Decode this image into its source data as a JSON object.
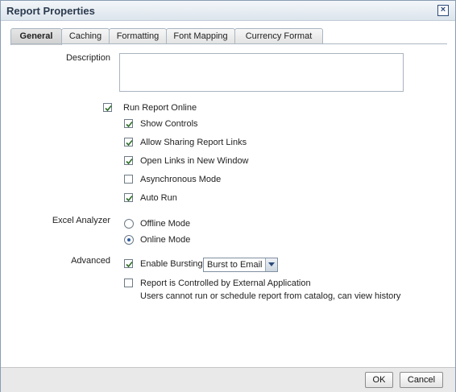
{
  "dialog": {
    "title": "Report Properties",
    "close_symbol": "×"
  },
  "tabs": [
    {
      "label": "General"
    },
    {
      "label": "Caching"
    },
    {
      "label": "Formatting"
    },
    {
      "label": "Font Mapping"
    },
    {
      "label": "Currency Format"
    }
  ],
  "general": {
    "description_label": "Description",
    "description_value": "",
    "run_report_online": {
      "label": "Run Report Online",
      "checked": true
    },
    "show_controls": {
      "label": "Show Controls",
      "checked": true
    },
    "allow_sharing": {
      "label": "Allow Sharing Report Links",
      "checked": true
    },
    "open_links_new_window": {
      "label": "Open Links in New Window",
      "checked": true
    },
    "asynchronous_mode": {
      "label": "Asynchronous Mode",
      "checked": false
    },
    "auto_run": {
      "label": "Auto Run",
      "checked": true
    },
    "excel_analyzer_label": "Excel Analyzer",
    "offline_mode": {
      "label": "Offline Mode",
      "selected": false
    },
    "online_mode": {
      "label": "Online Mode",
      "selected": true
    },
    "advanced_label": "Advanced",
    "enable_bursting": {
      "label": "Enable Bursting",
      "checked": true
    },
    "burst_select_value": "Burst to Email",
    "external_app": {
      "label": "Report is Controlled by External Application",
      "checked": false
    },
    "external_app_note": "Users cannot run or schedule report from catalog, can view history"
  },
  "footer": {
    "ok_label": "OK",
    "cancel_label": "Cancel"
  },
  "colors": {
    "check": "#2f6f2a",
    "radio_dot": "#2e5e9e"
  },
  "icons": {
    "close": "close-icon",
    "dropdown": "chevron-down-icon",
    "checkmark": "checkmark-icon"
  }
}
